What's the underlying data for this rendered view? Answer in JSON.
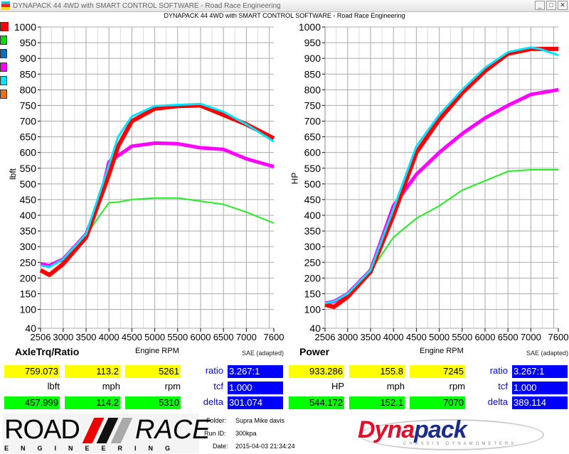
{
  "window": {
    "title": "DYNAPACK 44 4WD with SMART CONTROL SOFTWARE - Road Race Engineering",
    "minimize": "_",
    "maximize": "□",
    "close": "✕"
  },
  "subtitle": "DYNAPACK 44 4WD with SMART CONTROL SOFTWARE - Road Race Engineering",
  "legend_colors": [
    "#ff0000",
    "#00dd00",
    "#0070c0",
    "#ff00ff",
    "#00e5ff",
    "#f07010"
  ],
  "chart_data": [
    {
      "type": "line",
      "title": "AxleTrq/Ratio",
      "xlabel": "Engine RPM",
      "ylabel": "lbft",
      "note": "SAE (adapted)",
      "xlim": [
        2506,
        7600
      ],
      "ylim": [
        40,
        1000
      ],
      "xticks": [
        2506,
        3000,
        3500,
        4000,
        4500,
        5000,
        5500,
        6000,
        6500,
        7000,
        7600
      ],
      "yticks": [
        1000,
        950,
        900,
        850,
        800,
        750,
        700,
        650,
        600,
        550,
        500,
        450,
        400,
        350,
        300,
        250,
        200,
        150,
        100,
        40
      ],
      "series": [
        {
          "name": "green",
          "color": "#22ee22",
          "x": [
            2506,
            2700,
            3000,
            3500,
            3800,
            4000,
            4200,
            4500,
            5000,
            5500,
            6000,
            6500,
            7000,
            7600
          ],
          "y": [
            240,
            238,
            258,
            335,
            400,
            440,
            442,
            450,
            455,
            455,
            445,
            435,
            410,
            375
          ]
        },
        {
          "name": "magenta",
          "color": "#ff00ff",
          "x": [
            2506,
            2700,
            3000,
            3500,
            3800,
            4000,
            4200,
            4500,
            5000,
            5500,
            6000,
            6500,
            7000,
            7600
          ],
          "y": [
            245,
            240,
            260,
            340,
            450,
            570,
            590,
            620,
            630,
            628,
            615,
            610,
            580,
            555
          ]
        },
        {
          "name": "red",
          "color": "#ff0000",
          "x": [
            2506,
            2700,
            3000,
            3500,
            4000,
            4200,
            4500,
            5000,
            5500,
            6000,
            6500,
            7000,
            7600
          ],
          "y": [
            225,
            210,
            245,
            330,
            530,
            620,
            700,
            740,
            748,
            750,
            720,
            690,
            645
          ]
        },
        {
          "name": "cyan",
          "color": "#00e5ff",
          "x": [
            2506,
            2700,
            3000,
            3500,
            4000,
            4200,
            4500,
            5000,
            5500,
            6000,
            6500,
            7000,
            7600
          ],
          "y": [
            240,
            235,
            260,
            340,
            560,
            650,
            715,
            748,
            752,
            755,
            730,
            690,
            635
          ]
        }
      ]
    },
    {
      "type": "line",
      "title": "Power",
      "xlabel": "Engine RPM",
      "ylabel": "HP",
      "note": "SAE (adapted)",
      "xlim": [
        2506,
        7600
      ],
      "ylim": [
        40,
        1000
      ],
      "xticks": [
        2506,
        3000,
        3500,
        4000,
        4500,
        5000,
        5500,
        6000,
        6500,
        7000,
        7600
      ],
      "yticks": [
        1000,
        950,
        900,
        850,
        800,
        750,
        700,
        650,
        600,
        550,
        500,
        450,
        400,
        350,
        300,
        250,
        200,
        150,
        100,
        40
      ],
      "series": [
        {
          "name": "green",
          "color": "#22ee22",
          "x": [
            2506,
            3000,
            3500,
            4000,
            4500,
            5000,
            5500,
            6000,
            6500,
            7000,
            7600
          ],
          "y": [
            115,
            148,
            222,
            330,
            390,
            430,
            480,
            510,
            540,
            545,
            545
          ]
        },
        {
          "name": "magenta",
          "color": "#ff00ff",
          "x": [
            2506,
            2700,
            3000,
            3500,
            4000,
            4500,
            5000,
            5500,
            6000,
            6500,
            7000,
            7600
          ],
          "y": [
            120,
            125,
            150,
            225,
            430,
            530,
            600,
            660,
            710,
            750,
            785,
            800
          ]
        },
        {
          "name": "red",
          "color": "#ff0000",
          "x": [
            2506,
            2700,
            3000,
            3500,
            4000,
            4500,
            5000,
            5500,
            6000,
            6500,
            7000,
            7600
          ],
          "y": [
            115,
            108,
            140,
            220,
            400,
            600,
            705,
            790,
            860,
            915,
            930,
            930
          ]
        },
        {
          "name": "cyan",
          "color": "#00e5ff",
          "x": [
            2506,
            2700,
            3000,
            3500,
            4000,
            4500,
            5000,
            5500,
            6000,
            6500,
            7000,
            7200,
            7600
          ],
          "y": [
            120,
            125,
            150,
            225,
            420,
            620,
            720,
            800,
            870,
            920,
            935,
            930,
            910
          ]
        }
      ]
    }
  ],
  "panels": [
    {
      "title": "AxleTrq/Ratio",
      "xlabel": "Engine RPM",
      "note": "SAE (adapted)",
      "row1": [
        "759.073",
        "113.2",
        "5261"
      ],
      "units": [
        "lbft",
        "mph",
        "rpm"
      ],
      "row2": [
        "457.999",
        "114.2",
        "5310"
      ],
      "ratio_label": "ratio",
      "ratio": "3.267:1",
      "tcf_label": "tcf",
      "tcf": "1.000",
      "delta_label": "delta",
      "delta": "301.074"
    },
    {
      "title": "Power",
      "xlabel": "Engine RPM",
      "note": "SAE (adapted)",
      "row1": [
        "933.286",
        "155.8",
        "7245"
      ],
      "units": [
        "HP",
        "mph",
        "rpm"
      ],
      "row2": [
        "544.172",
        "152.1",
        "7070"
      ],
      "ratio_label": "ratio",
      "ratio": "3.267:1",
      "tcf_label": "tcf",
      "tcf": "1.000",
      "delta_label": "delta",
      "delta": "389.114"
    }
  ],
  "info": {
    "folder_label": "Folder:",
    "folder": "Supra Mike davis",
    "run_label": "Run ID:",
    "run": "300kpa",
    "date_label": "Date:",
    "date": "2015-04-03 21:34:24"
  },
  "logos": {
    "road_race": "ROAD RACE ENGINEERING",
    "dynapack": "Dynapack",
    "dynapack_sub": "CHASSIS DYNAMOMETERS"
  }
}
